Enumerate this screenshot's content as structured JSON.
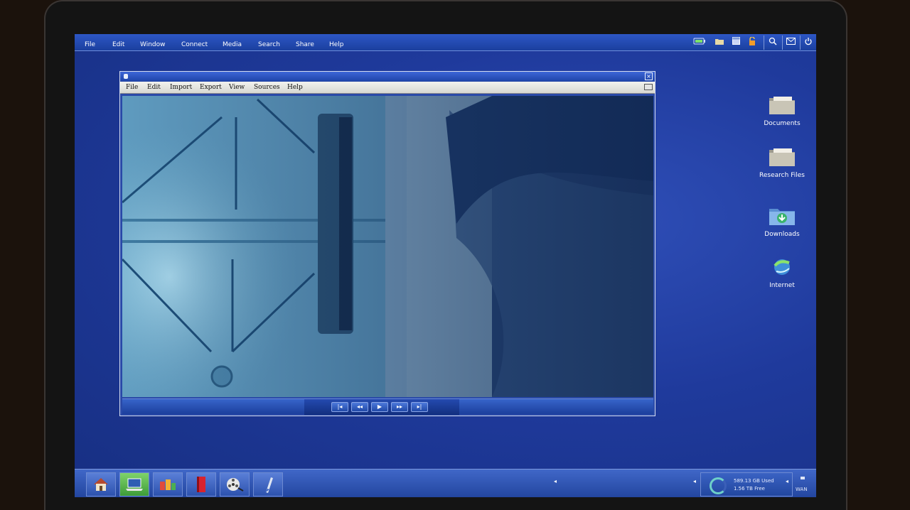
{
  "menubar": {
    "items": [
      "File",
      "Edit",
      "Window",
      "Connect",
      "Media",
      "Search",
      "Share",
      "Help"
    ],
    "tray_icons": [
      "battery-icon",
      "folder-icon",
      "window-icon",
      "lock-icon",
      "search-icon",
      "mail-icon",
      "power-icon"
    ]
  },
  "media_window": {
    "menu": [
      "File",
      "Edit",
      "Import",
      "Export",
      "View",
      "Sources",
      "Help"
    ],
    "controls": [
      "skip-back-icon",
      "rewind-icon",
      "play-icon",
      "fast-forward-icon",
      "skip-forward-icon"
    ],
    "control_glyphs": [
      "|◂",
      "◂◂",
      "▶",
      "▸▸",
      "▸|"
    ]
  },
  "desktop_icons": [
    {
      "label": "Documents",
      "icon": "folder-icon"
    },
    {
      "label": "Research Files",
      "icon": "folder-icon"
    },
    {
      "label": "Downloads",
      "icon": "downloads-folder-icon"
    },
    {
      "label": "Internet",
      "icon": "globe-icon"
    }
  ],
  "taskbar": {
    "apps": [
      "home-icon",
      "laptop-icon",
      "apps-icon",
      "book-icon",
      "film-reel-icon",
      "pen-icon"
    ],
    "storage": {
      "used": "589.13 GB Used",
      "free": "1.56 TB Free"
    },
    "network_label": "WAN"
  },
  "colors": {
    "desktop": "#1f3a9c",
    "menubar": "#2d57c6",
    "accent": "#6ed0c9"
  }
}
